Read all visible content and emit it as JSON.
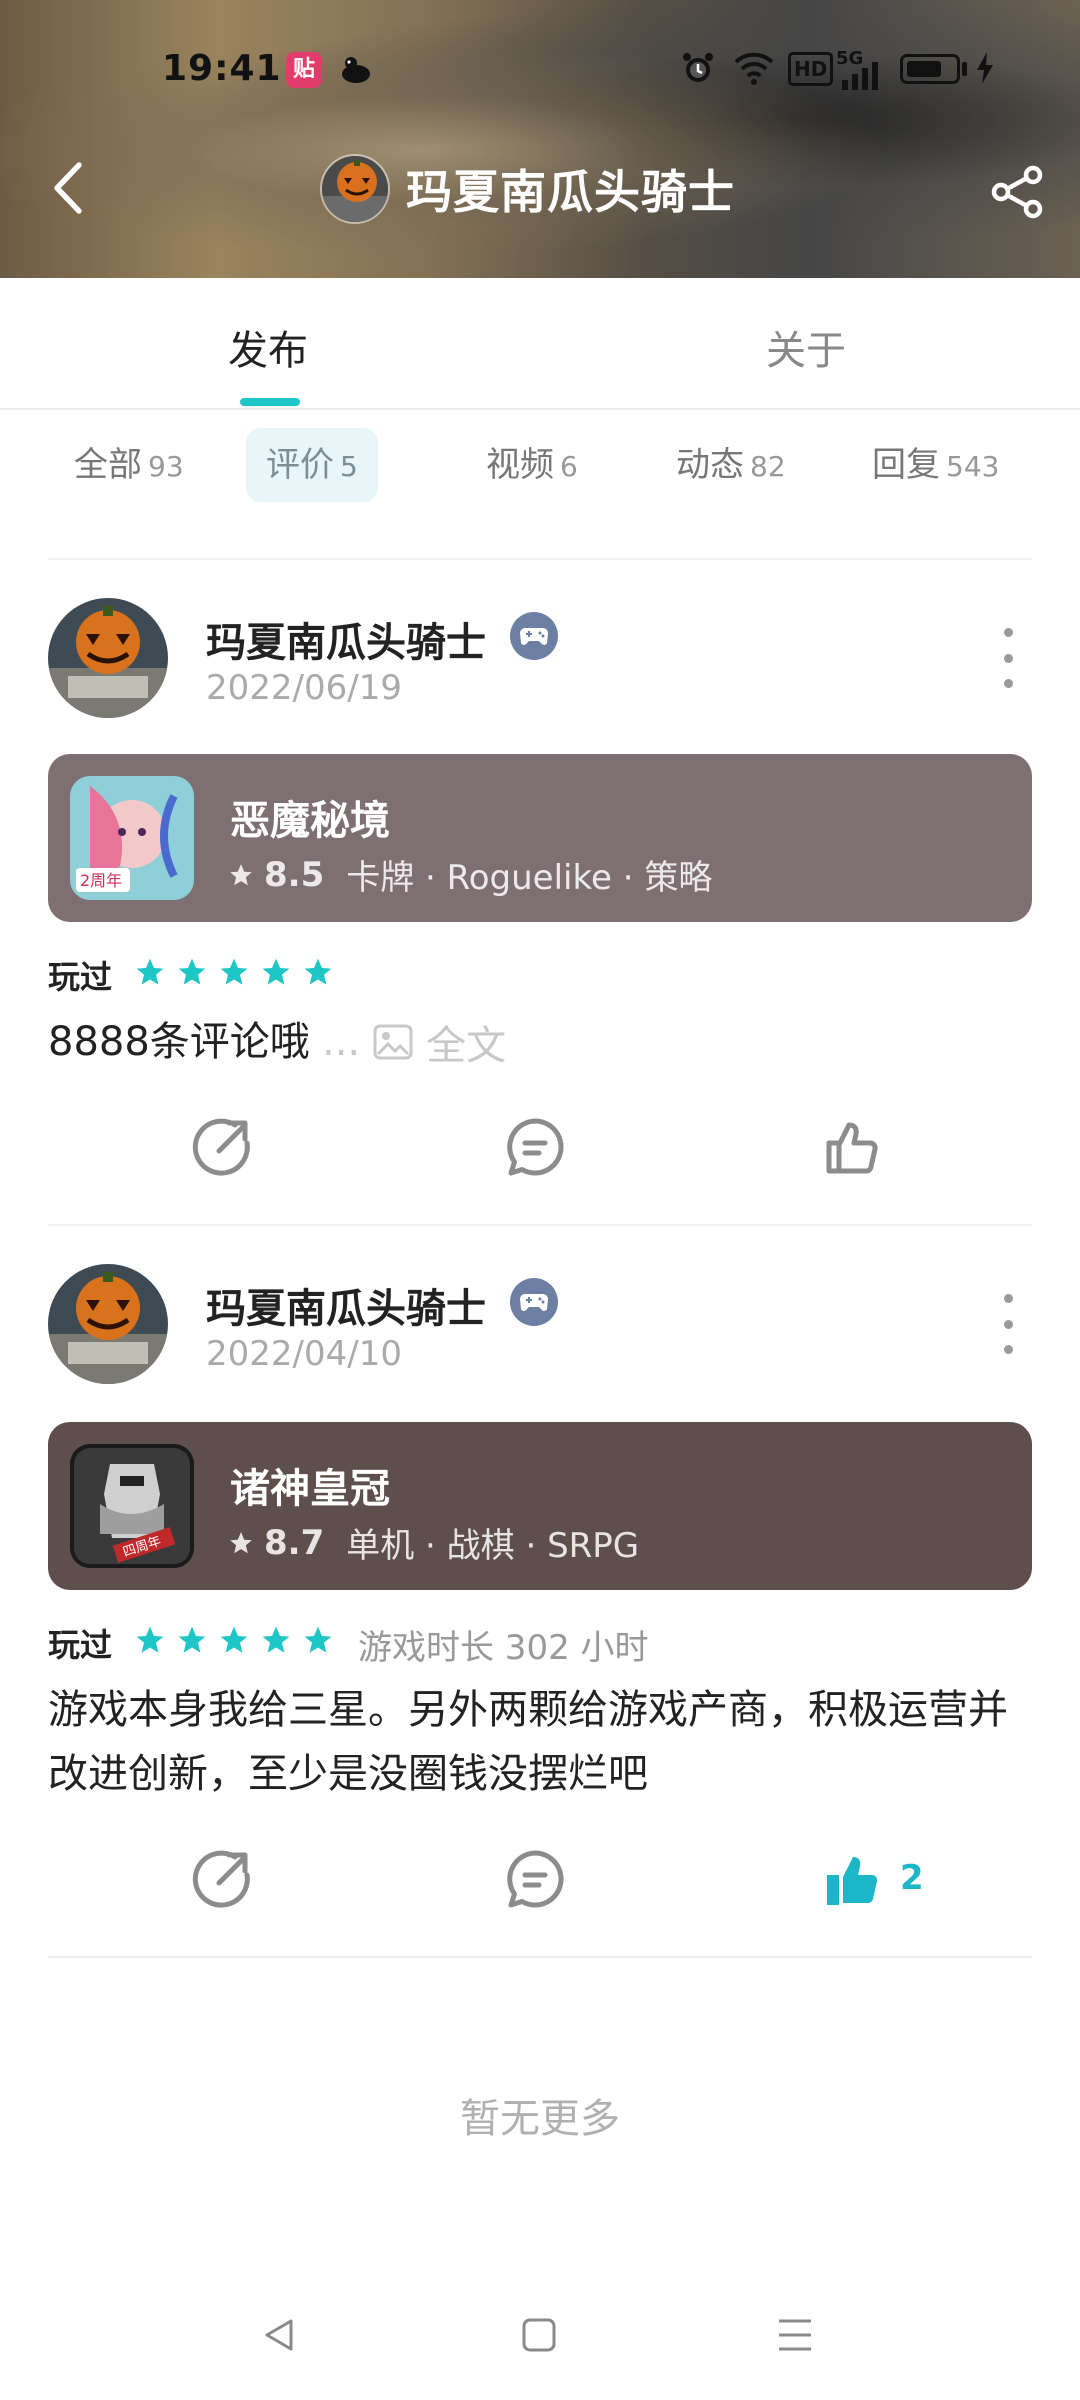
{
  "status_bar": {
    "time": "19:41",
    "app_icon_1_text": "贴",
    "hd": "HD",
    "network": "5G"
  },
  "header": {
    "title": "玛夏南瓜头骑士"
  },
  "tabs": [
    {
      "label": "发布",
      "active": true
    },
    {
      "label": "关于",
      "active": false
    }
  ],
  "filters": [
    {
      "label": "全部",
      "count": "93",
      "active": false
    },
    {
      "label": "评价",
      "count": "5",
      "active": true
    },
    {
      "label": "视频",
      "count": "6",
      "active": false
    },
    {
      "label": "动态",
      "count": "82",
      "active": false
    },
    {
      "label": "回复",
      "count": "543",
      "active": false
    }
  ],
  "posts": [
    {
      "user": "玛夏南瓜头骑士",
      "date": "2022/06/19",
      "game": {
        "name": "恶魔秘境",
        "score": "8.5",
        "tags": "卡牌 · Roguelike · 策略",
        "card_color": "#7e6f72",
        "icon_badge": "2周年"
      },
      "played_label": "玩过",
      "rating": 5,
      "playtime": "",
      "content": "8888条评论哦",
      "ellipsis": "...",
      "fulltext_label": "全文",
      "likes": ""
    },
    {
      "user": "玛夏南瓜头骑士",
      "date": "2022/04/10",
      "game": {
        "name": "诸神皇冠",
        "score": "8.7",
        "tags": "单机 · 战棋 · SRPG",
        "card_color": "#5f4f4c",
        "icon_badge": "四周年"
      },
      "played_label": "玩过",
      "rating": 5,
      "playtime": "游戏时长 302 小时",
      "content": "游戏本身我给三星。另外两颗给游戏产商，积极运营并改进创新，至少是没圈钱没摆烂吧",
      "likes": "2"
    }
  ],
  "footer": {
    "no_more": "暂无更多"
  },
  "colors": {
    "accent": "#1fc6c6",
    "star": "#1fc6c6",
    "liked": "#1bb6c8"
  }
}
